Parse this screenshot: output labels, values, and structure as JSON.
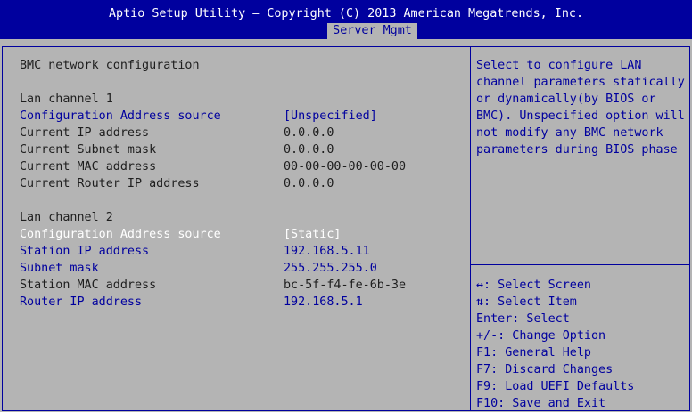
{
  "header": {
    "title": "Aptio Setup Utility – Copyright (C) 2013 American Megatrends, Inc.",
    "active_tab": "Server Mgmt"
  },
  "main": {
    "section_title": "BMC network configuration",
    "lan1": {
      "heading": "Lan channel 1",
      "rows": [
        {
          "label": "Configuration Address source",
          "value": "[Unspecified]"
        },
        {
          "label": "Current IP address",
          "value": "0.0.0.0"
        },
        {
          "label": "Current Subnet mask",
          "value": "0.0.0.0"
        },
        {
          "label": "Current MAC address",
          "value": "00-00-00-00-00-00"
        },
        {
          "label": "Current Router IP address",
          "value": "0.0.0.0"
        }
      ]
    },
    "lan2": {
      "heading": "Lan channel 2",
      "rows": [
        {
          "label": "Configuration Address source",
          "value": "[Static]"
        },
        {
          "label": "Station IP address",
          "value": "192.168.5.11"
        },
        {
          "label": "Subnet mask",
          "value": "255.255.255.0"
        },
        {
          "label": "Station MAC address",
          "value": "bc-5f-f4-fe-6b-3e"
        },
        {
          "label": "Router IP address",
          "value": "192.168.5.1"
        }
      ]
    }
  },
  "help_panel": {
    "lines": [
      "Select to configure LAN",
      "channel parameters statically",
      "or dynamically(by BIOS or",
      "BMC). Unspecified option will",
      "not modify any BMC network",
      "parameters during BIOS phase"
    ]
  },
  "key_legend": {
    "lines": [
      "↔: Select Screen",
      "⇅: Select Item",
      "Enter: Select",
      "+/-: Change Option",
      "F1: General Help",
      "F7: Discard Changes",
      "F9: Load UEFI Defaults",
      "F10: Save and Exit"
    ]
  },
  "colors": {
    "background": "#b4b4b4",
    "header": "#00009e",
    "selectable_text": "#00009e",
    "static_text": "#1e1e1e",
    "highlight_text": "#ffffff"
  }
}
